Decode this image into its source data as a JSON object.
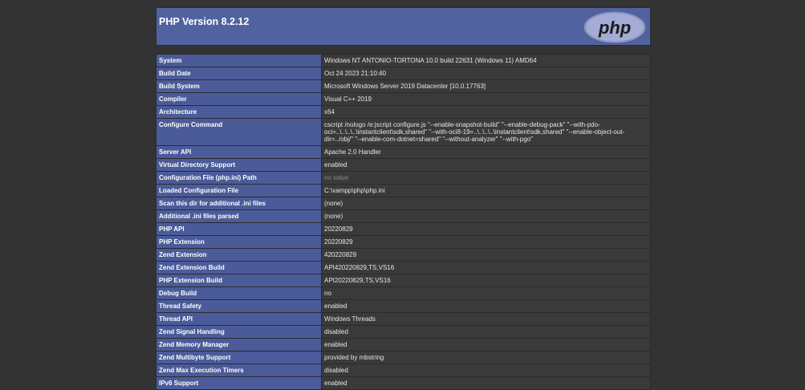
{
  "header": {
    "title": "PHP Version 8.2.12",
    "logo_text": "php"
  },
  "rows": [
    {
      "key": "System",
      "value": "Windows NT ANTONIO-TORTONA 10.0 build 22631 (Windows 11) AMD64"
    },
    {
      "key": "Build Date",
      "value": "Oct 24 2023 21:10:40"
    },
    {
      "key": "Build System",
      "value": "Microsoft Windows Server 2019 Datacenter [10.0.17763]"
    },
    {
      "key": "Compiler",
      "value": "Visual C++ 2019"
    },
    {
      "key": "Architecture",
      "value": "x64"
    },
    {
      "key": "Configure Command",
      "value": "cscript /nologo /e:jscript configure.js \"--enable-snapshot-build\" \"--enable-debug-pack\" \"--with-pdo-oci=..\\..\\..\\..\\instantclient\\sdk,shared\" \"--with-oci8-19=..\\..\\..\\..\\instantclient\\sdk,shared\" \"--enable-object-out-dir=../obj/\" \"--enable-com-dotnet=shared\" \"--without-analyzer\" \"--with-pgo\""
    },
    {
      "key": "Server API",
      "value": "Apache 2.0 Handler"
    },
    {
      "key": "Virtual Directory Support",
      "value": "enabled"
    },
    {
      "key": "Configuration File (php.ini) Path",
      "value": "no value"
    },
    {
      "key": "Loaded Configuration File",
      "value": "C:\\xampp\\php\\php.ini"
    },
    {
      "key": "Scan this dir for additional .ini files",
      "value": "(none)"
    },
    {
      "key": "Additional .ini files parsed",
      "value": "(none)"
    },
    {
      "key": "PHP API",
      "value": "20220829"
    },
    {
      "key": "PHP Extension",
      "value": "20220829"
    },
    {
      "key": "Zend Extension",
      "value": "420220829"
    },
    {
      "key": "Zend Extension Build",
      "value": "API420220829,TS,VS16"
    },
    {
      "key": "PHP Extension Build",
      "value": "API20220829,TS,VS16"
    },
    {
      "key": "Debug Build",
      "value": "no"
    },
    {
      "key": "Thread Safety",
      "value": "enabled"
    },
    {
      "key": "Thread API",
      "value": "Windows Threads"
    },
    {
      "key": "Zend Signal Handling",
      "value": "disabled"
    },
    {
      "key": "Zend Memory Manager",
      "value": "enabled"
    },
    {
      "key": "Zend Multibyte Support",
      "value": "provided by mbstring"
    },
    {
      "key": "Zend Max Execution Timers",
      "value": "disabled"
    },
    {
      "key": "IPv6 Support",
      "value": "enabled"
    }
  ],
  "colors": {
    "page_bg": "#333333",
    "header_bg": "#5162a0",
    "key_bg": "#4b5b9a",
    "value_bg": "#3a3a3a"
  }
}
